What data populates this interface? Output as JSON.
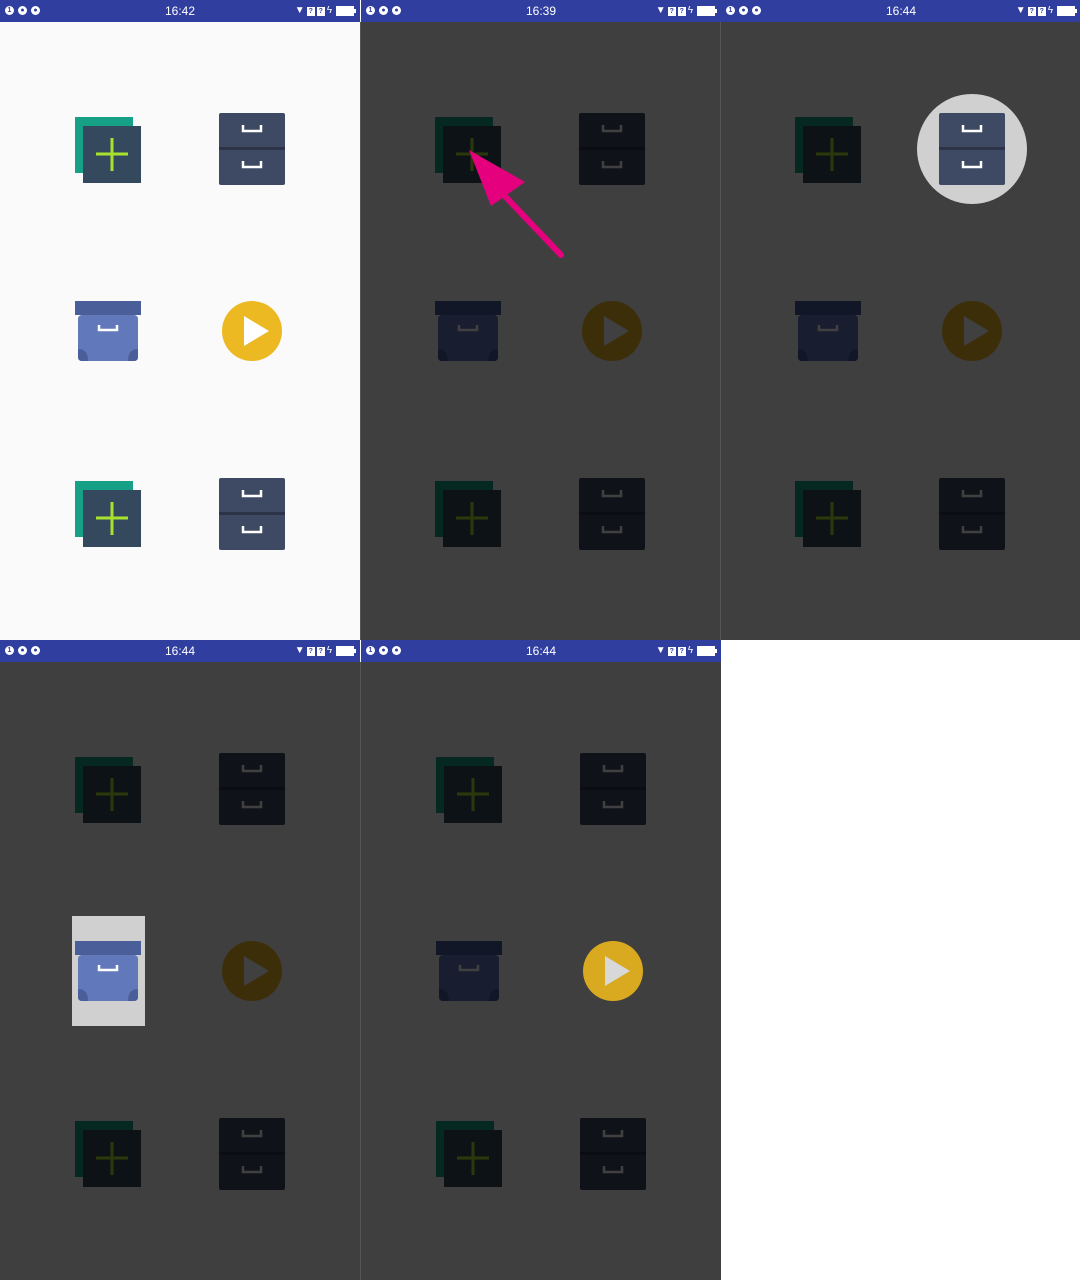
{
  "colors": {
    "status_bar": "#303f9f",
    "background": "#fafafa",
    "teal": "#16a085",
    "slate": "#34495e",
    "plus": "#a6e22e",
    "cabinet": "#3e4963",
    "archive": "#6178bb",
    "archive_lid": "#4a5e9a",
    "play": "#ecb923",
    "dim_overlay": "rgba(0,0,0,0.75)",
    "highlight": "#d0d0d0",
    "arrow": "#e5007e"
  },
  "icons": [
    "add-item-icon",
    "file-cabinet-icon",
    "archive-box-icon",
    "play-icon",
    "add-item-icon",
    "file-cabinet-icon"
  ],
  "panels": [
    {
      "time": "16:42",
      "dimmed": false,
      "highlight": null
    },
    {
      "time": "16:39",
      "dimmed": true,
      "highlight": null,
      "pointer": "arrow"
    },
    {
      "time": "16:44",
      "dimmed": true,
      "highlight": "file-cabinet-icon"
    },
    {
      "time": "16:44",
      "dimmed": true,
      "highlight": "archive-box-icon"
    },
    {
      "time": "16:44",
      "dimmed": true,
      "highlight": "play-icon"
    }
  ]
}
